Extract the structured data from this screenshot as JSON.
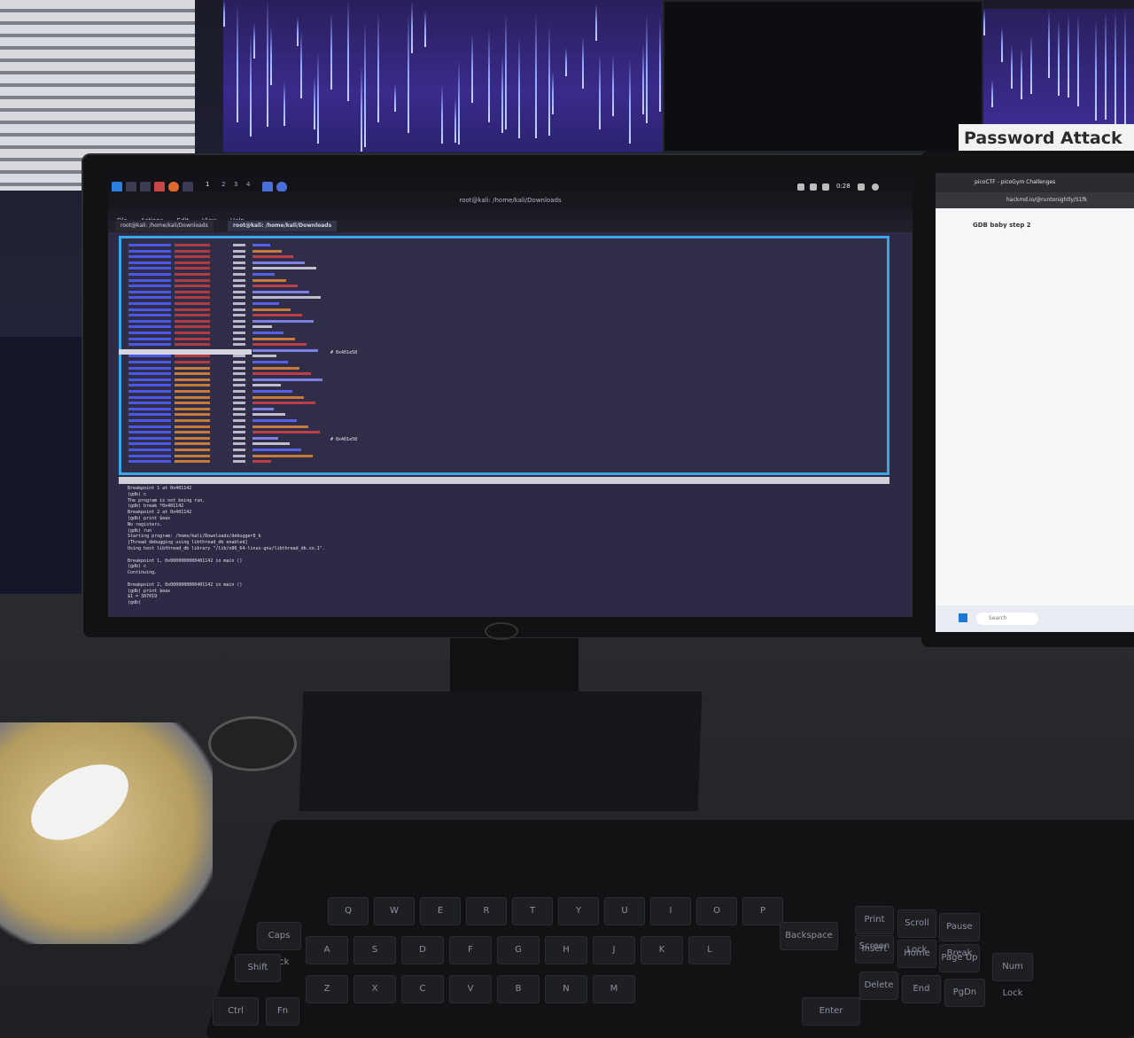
{
  "scene": {
    "sign_text": "Password Attack"
  },
  "main_monitor": {
    "taskbar": {
      "workspaces": [
        "1",
        "2",
        "3",
        "4"
      ],
      "clock": "0:28"
    },
    "window_title": "root@kali: /home/kali/Downloads",
    "menu": [
      "File",
      "Actions",
      "Edit",
      "View",
      "Help"
    ],
    "tabs": [
      {
        "label": "root@kali: /home/kali/Downloads"
      },
      {
        "label": "root@kali: /home/kali/Downloads"
      }
    ],
    "tui": {
      "comment_1": "# 0x401e58",
      "comment_2": "# 0x401e58"
    },
    "gdb_console": [
      "Breakpoint 1 at 0x401142",
      "(gdb) c",
      "The program is not being run.",
      "(gdb) break *0x401142",
      "Breakpoint 2 at 0x401142",
      "(gdb) print $eax",
      "No registers.",
      "(gdb) run",
      "Starting program: /home/kali/Downloads/debugger0_b",
      "[Thread debugging using libthread_db enabled]",
      "Using host libthread_db library \"/lib/x86_64-linux-gnu/libthread_db.so.1\".",
      "",
      "Breakpoint 1, 0x0000000000401142 in main ()",
      "(gdb) c",
      "Continuing.",
      "",
      "Breakpoint 2, 0x0000000000401142 in main ()",
      "(gdb) print $eax",
      "$1 = 307019",
      "(gdb) "
    ]
  },
  "right_monitor": {
    "browser_tab": "picoCTF - picoGym Challenges",
    "address": "hackmd.io/@runtonightly/S1fk",
    "page_heading": "GDB baby step 2",
    "search_placeholder": "Search"
  },
  "keyboard": {
    "letters_row1": [
      "Q",
      "W",
      "E",
      "R",
      "T",
      "Y",
      "U",
      "I",
      "O",
      "P"
    ],
    "letters_row2": [
      "A",
      "S",
      "D",
      "F",
      "G",
      "H",
      "J",
      "K",
      "L"
    ],
    "letters_row3": [
      "Z",
      "X",
      "C",
      "V",
      "B",
      "N",
      "M"
    ],
    "special": {
      "backspace": "Backspace",
      "enter": "Enter",
      "shift": "Shift",
      "ctrl": "Ctrl",
      "capslock": "Caps Lock",
      "fn": "Fn",
      "insert": "Insert",
      "home": "Home",
      "pgup": "Page Up",
      "delete": "Delete",
      "end": "End",
      "pgdn": "PgDn",
      "numlock": "Num Lock",
      "prtscr": "Print Screen",
      "scroll": "Scroll Lock",
      "pause": "Pause Break"
    }
  }
}
